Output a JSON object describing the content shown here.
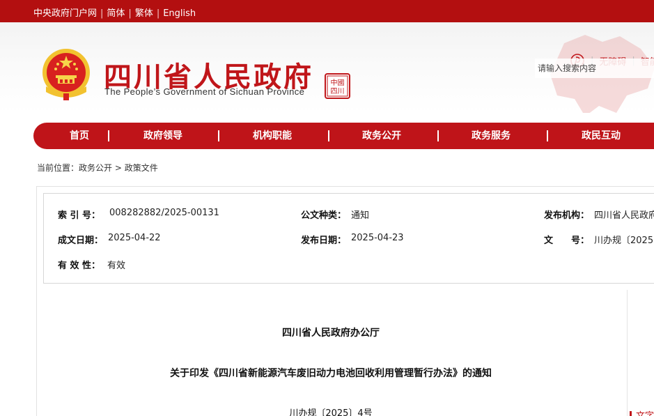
{
  "topbar": {
    "links": [
      "中央政府门户网",
      "简体",
      "繁体",
      "English"
    ],
    "separator": "|"
  },
  "header": {
    "title_cn": "四川省人民政府",
    "title_en": "The People’s Government of Sichuan Province",
    "seal_text": "中国四川",
    "accessibility_label": "无障碍",
    "smart_label": "智能",
    "search_placeholder": "请输入搜索内容"
  },
  "nav": {
    "items": [
      "首页",
      "政府领导",
      "机构职能",
      "政务公开",
      "政务服务",
      "政民互动"
    ],
    "separator": "|"
  },
  "breadcrumb": {
    "prefix": "当前位置：",
    "items": [
      "政务公开",
      "政策文件"
    ],
    "separator": ">"
  },
  "meta": {
    "index_label": "索 引 号：",
    "index_value": "008282882/2025-00131",
    "category_label": "公文种类：",
    "category_value": "通知",
    "issuer_label": "发布机构：",
    "issuer_value": "四川省人民政府",
    "created_label": "成文日期：",
    "created_value": "2025-04-22",
    "published_label": "发布日期：",
    "published_value": "2025-04-23",
    "docno_label": "文　　号：",
    "docno_value": "川办规〔2025",
    "validity_label": "有 效 性：",
    "validity_value": "有效"
  },
  "document": {
    "issuer": "四川省人民政府办公厅",
    "title": "关于印发《四川省新能源汽车废旧动力电池回收利用管理暂行办法》的通知",
    "number": "川办规〔2025〕4号"
  },
  "side": {
    "tab_label": "文字"
  },
  "colors": {
    "brand_red": "#b30f10",
    "nav_red": "#bf1419",
    "title_red": "#c0161a"
  },
  "icons": [
    "national-emblem-icon",
    "seal-icon",
    "pin-icon"
  ]
}
